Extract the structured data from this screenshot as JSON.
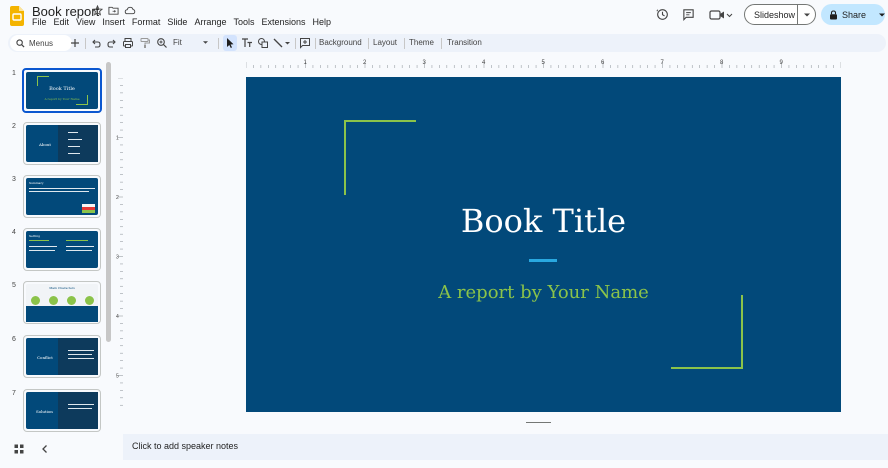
{
  "header": {
    "doc_title": "Book report",
    "menus": [
      "File",
      "Edit",
      "View",
      "Insert",
      "Format",
      "Slide",
      "Arrange",
      "Tools",
      "Extensions",
      "Help"
    ],
    "slideshow_label": "Slideshow",
    "share_label": "Share"
  },
  "toolbar": {
    "search_placeholder": "Menus",
    "zoom_value": "Fit",
    "background_label": "Background",
    "layout_label": "Layout",
    "theme_label": "Theme",
    "transition_label": "Transition"
  },
  "filmstrip": {
    "slides": [
      {
        "number": "1",
        "title": "Book Title",
        "subtitle": "A report by Your Name"
      },
      {
        "number": "2",
        "title": "About"
      },
      {
        "number": "3",
        "title": "Summary"
      },
      {
        "number": "4",
        "title": "Setting"
      },
      {
        "number": "5",
        "title": "Main Characters"
      },
      {
        "number": "6",
        "title": "Conflict"
      },
      {
        "number": "7",
        "title": "Solution"
      }
    ]
  },
  "ruler": {
    "h_ticks": [
      "1",
      "2",
      "3",
      "4",
      "5",
      "6",
      "7",
      "8",
      "9"
    ],
    "v_ticks": [
      "1",
      "2",
      "3",
      "4",
      "5"
    ]
  },
  "slide": {
    "title": "Book Title",
    "subtitle": "A report by Your Name"
  },
  "notes": {
    "placeholder": "Click to add speaker notes"
  },
  "colors": {
    "slide_bg": "#02497a",
    "accent_green": "#8bc34a",
    "accent_blue": "#29a8e0",
    "share_bg": "#c2e7ff"
  }
}
